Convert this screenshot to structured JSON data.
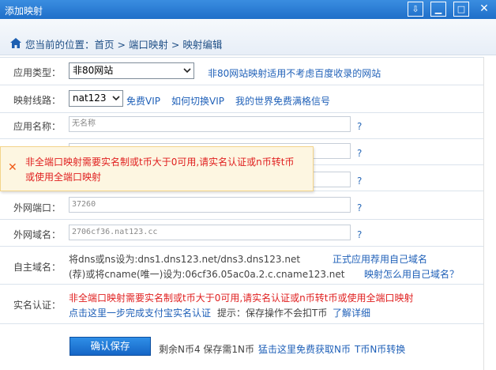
{
  "window": {
    "title": "添加映射"
  },
  "breadcrumb": {
    "text": "您当前的位置：首页 > 端口映射 > 映射编辑"
  },
  "form": {
    "app_type": {
      "label": "应用类型：",
      "value": "非80网站",
      "hint": "非80网站映射适用不考虑百度收录的网站"
    },
    "line": {
      "label": "映射线路：",
      "value": "nat123",
      "free_vip": "免费VIP",
      "switch_vip": "如何切换VIP",
      "world": "我的世界免费满格信号"
    },
    "app_name": {
      "label": "应用名称：",
      "placeholder": "无名称",
      "help": "?"
    },
    "row4": {
      "help": "?"
    },
    "row5": {
      "help": "?"
    },
    "ext_port": {
      "label": "外网端口：",
      "value": "37260",
      "help": "?"
    },
    "ext_domain": {
      "label": "外网域名：",
      "value": "2706cf36.nat123.cc",
      "help": "?"
    },
    "own_domain": {
      "label": "自主域名：",
      "line1": "将dns或ns设为:dns1.dns123.net/dns3.dns123.net",
      "line1_link": "正式应用荐用自己域名",
      "line2": "(荐)或将cname(唯一)设为:06cf36.05ac0a.2.c.cname123.net",
      "line2_link": "映射怎么用自己域名？"
    },
    "realname": {
      "label": "实名认证：",
      "warning": "非全端口映射需要实名制或t币大于0可用,请实名认证或n币转t币或使用全端口映射",
      "alipay_link": "点击这里一步完成支付宝实名认证",
      "tip": "提示：保存操作不会扣T币",
      "learn_more": "了解详细"
    }
  },
  "toast": {
    "message": "非全端口映射需要实名制或t币大于0可用,请实名认证或n币转t币或使用全端口映射"
  },
  "footer": {
    "save_button": "确认保存",
    "balance": "剩余N币4 保存需1N币",
    "get_link": "猛击这里免费获取N币",
    "convert_link": "T币N币转换"
  }
}
